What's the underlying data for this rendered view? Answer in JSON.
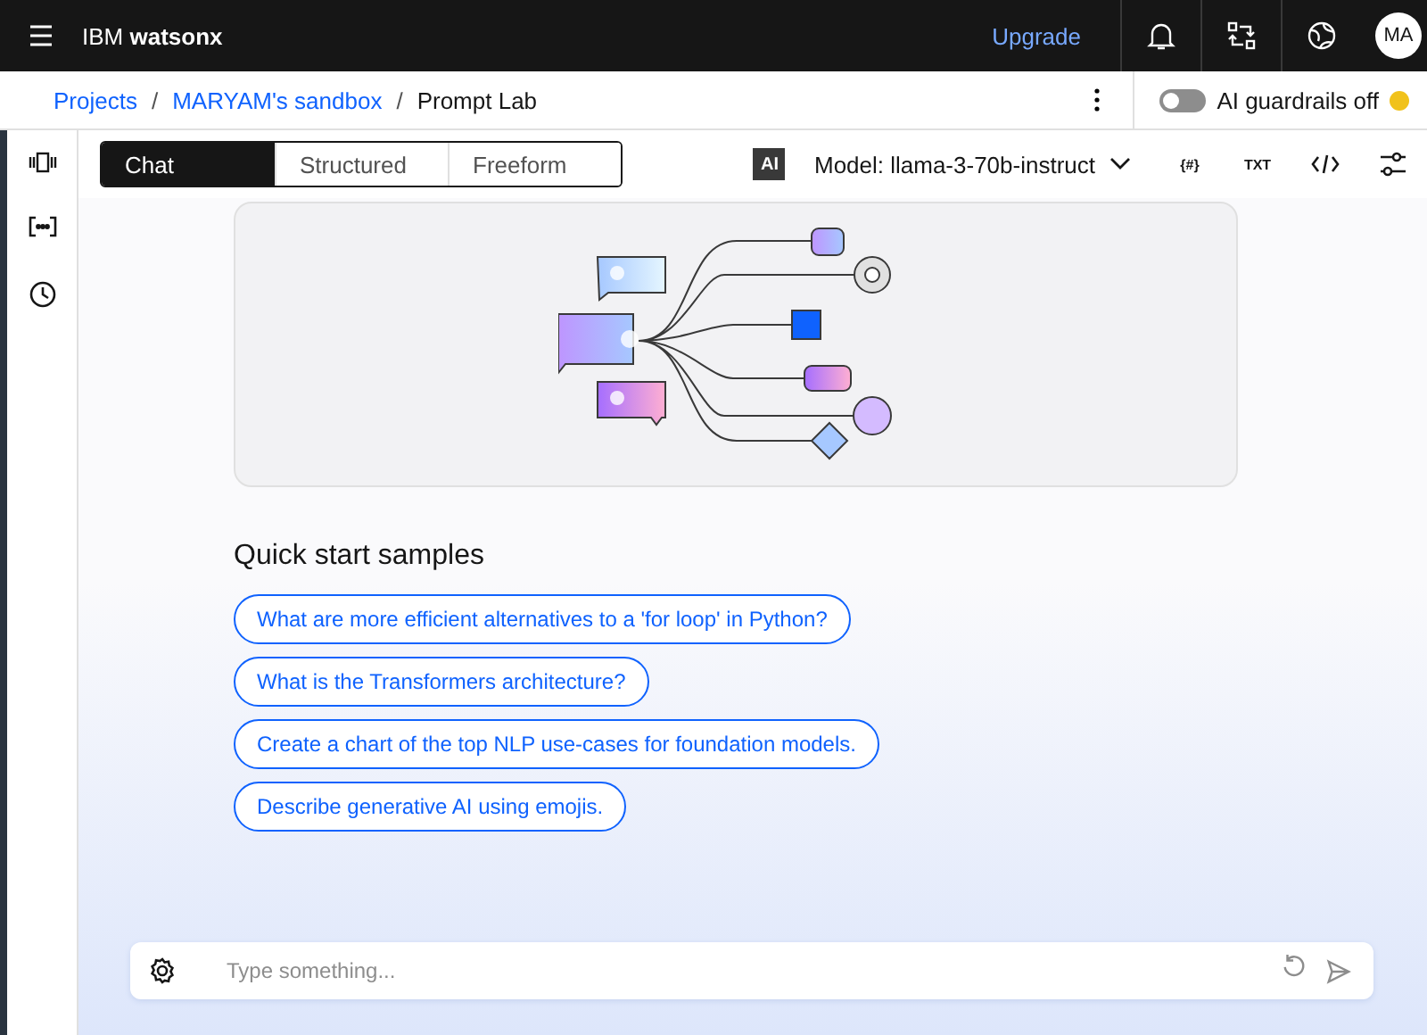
{
  "header": {
    "brand_prefix": "IBM",
    "brand_name": "watsonx",
    "upgrade": "Upgrade",
    "avatar": "MA"
  },
  "breadcrumb_separators": [
    "/",
    "/"
  ],
  "breadcrumbs": [
    {
      "label": "Projects",
      "link": true
    },
    {
      "label": "MARYAM's sandbox",
      "link": true
    },
    {
      "label": "Prompt Lab",
      "link": false
    }
  ],
  "guardrails": {
    "label": "AI guardrails off",
    "on": false
  },
  "mode_tabs": [
    {
      "label": "Chat",
      "selected": true
    },
    {
      "label": "Structured",
      "selected": false
    },
    {
      "label": "Freeform",
      "selected": false
    }
  ],
  "model": {
    "badge": "AI",
    "label": "Model: llama-3-70b-instruct"
  },
  "toolbar_icons": [
    {
      "text": "{#}"
    },
    {
      "text": "TXT"
    }
  ],
  "quick_start": {
    "title": "Quick start samples",
    "samples": [
      "What are more efficient alternatives to a 'for loop' in Python?",
      "What is the Transformers architecture?",
      "Create a chart of the top NLP use-cases for foundation models.",
      "Describe generative AI using emojis."
    ]
  },
  "chat_input": {
    "placeholder": "Type something..."
  }
}
